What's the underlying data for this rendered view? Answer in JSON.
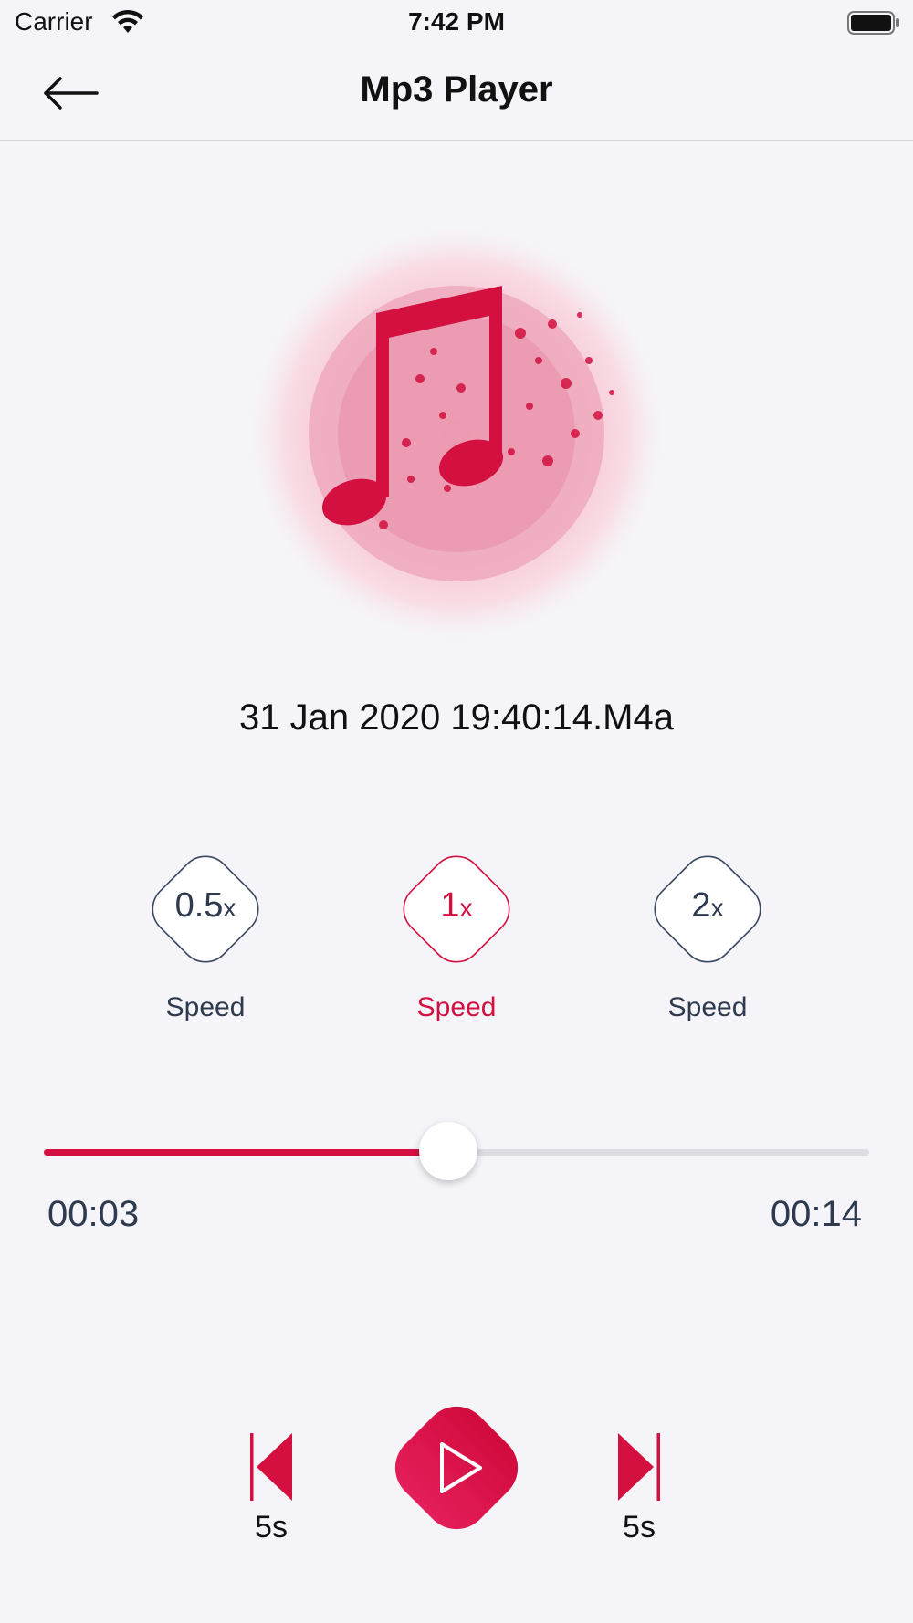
{
  "status_bar": {
    "carrier": "Carrier",
    "time": "7:42 PM",
    "icons": [
      "wifi-icon",
      "battery-icon"
    ]
  },
  "nav": {
    "title": "Mp3 Player",
    "back_icon": "arrow-left-icon"
  },
  "player": {
    "file_name": "31 Jan 2020 19:40:14.M4a",
    "speeds": [
      {
        "value": "0.5",
        "suffix": "x",
        "label": "Speed",
        "active": false
      },
      {
        "value": "1",
        "suffix": "x",
        "label": "Speed",
        "active": true
      },
      {
        "value": "2",
        "suffix": "x",
        "label": "Speed",
        "active": false
      }
    ],
    "progress": {
      "fraction": 0.49,
      "current_time": "00:03",
      "total_time": "00:14"
    },
    "skip_back_label": "5s",
    "skip_forward_label": "5s"
  },
  "colors": {
    "accent": "#D3103F",
    "text_dark": "#2E3A4F",
    "background": "#F5F5F9"
  }
}
